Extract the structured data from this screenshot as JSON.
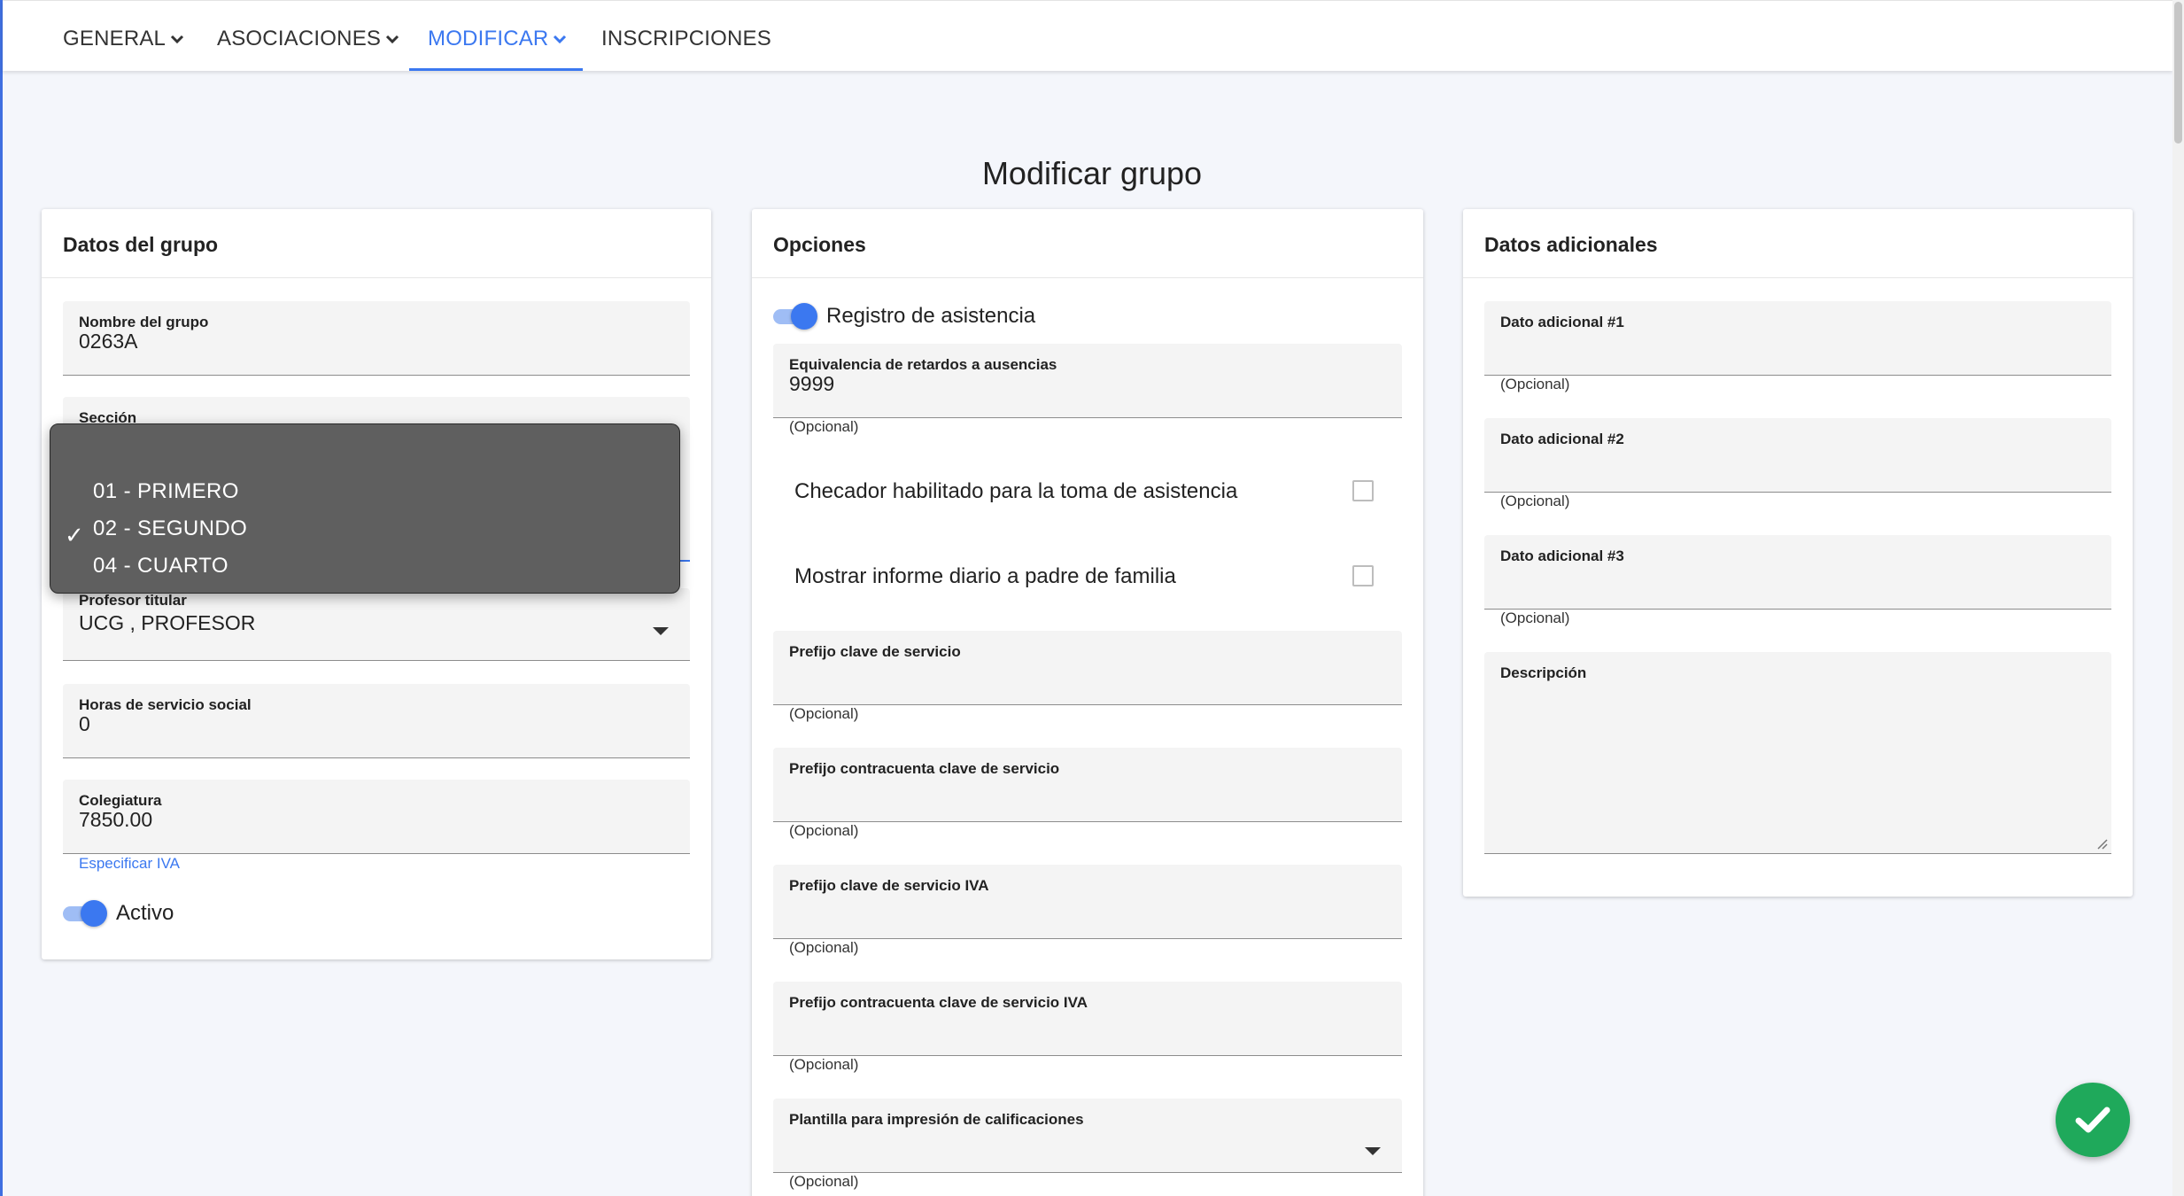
{
  "nav": {
    "tabs": [
      {
        "label": "GENERAL"
      },
      {
        "label": "ASOCIACIONES"
      },
      {
        "label": "MODIFICAR"
      },
      {
        "label": "INSCRIPCIONES"
      }
    ],
    "active_tab": "MODIFICAR"
  },
  "page_title": "Modificar grupo",
  "group_card": {
    "title": "Datos del grupo",
    "nombre": {
      "label": "Nombre del grupo",
      "value": "0263A"
    },
    "seccion": {
      "label": "Sección"
    },
    "seccion_dropdown": {
      "options": [
        "01 - PRIMERO",
        "02 - SEGUNDO",
        "04 - CUARTO"
      ],
      "selected": "02 - SEGUNDO"
    },
    "profesor": {
      "label": "Profesor titular",
      "value": "UCG , PROFESOR"
    },
    "horas": {
      "label": "Horas de servicio social",
      "value": "0"
    },
    "colegiatura": {
      "label": "Colegiatura",
      "value": "7850.00"
    },
    "iva_link": "Especificar IVA",
    "activo_label": "Activo"
  },
  "options_card": {
    "title": "Opciones",
    "asistencia_label": "Registro de asistencia",
    "equivalencia": {
      "label": "Equivalencia de retardos a ausencias",
      "value": "9999",
      "hint": "(Opcional)"
    },
    "checador_label": "Checador habilitado para la toma de asistencia",
    "informe_label": "Mostrar informe diario a padre de familia",
    "prefijo": {
      "label": "Prefijo clave de servicio",
      "hint": "(Opcional)"
    },
    "prefijo_contra": {
      "label": "Prefijo contracuenta clave de servicio",
      "hint": "(Opcional)"
    },
    "prefijo_iva": {
      "label": "Prefijo clave de servicio IVA",
      "hint": "(Opcional)"
    },
    "prefijo_contra_iva": {
      "label": "Prefijo contracuenta clave de servicio IVA",
      "hint": "(Opcional)"
    },
    "plantilla": {
      "label": "Plantilla para impresión de calificaciones",
      "hint": "(Opcional)"
    }
  },
  "extra_card": {
    "title": "Datos adicionales",
    "dato1": {
      "label": "Dato adicional #1",
      "hint": "(Opcional)"
    },
    "dato2": {
      "label": "Dato adicional #2",
      "hint": "(Opcional)"
    },
    "dato3": {
      "label": "Dato adicional #3",
      "hint": "(Opcional)"
    },
    "descripcion": {
      "label": "Descripción"
    }
  },
  "colors": {
    "accent": "#3b78f0",
    "fab": "#1fa95b"
  },
  "icons": {
    "nav_chevron": "chevron-down-icon",
    "fab": "check-icon",
    "select": "caret-down-icon"
  }
}
